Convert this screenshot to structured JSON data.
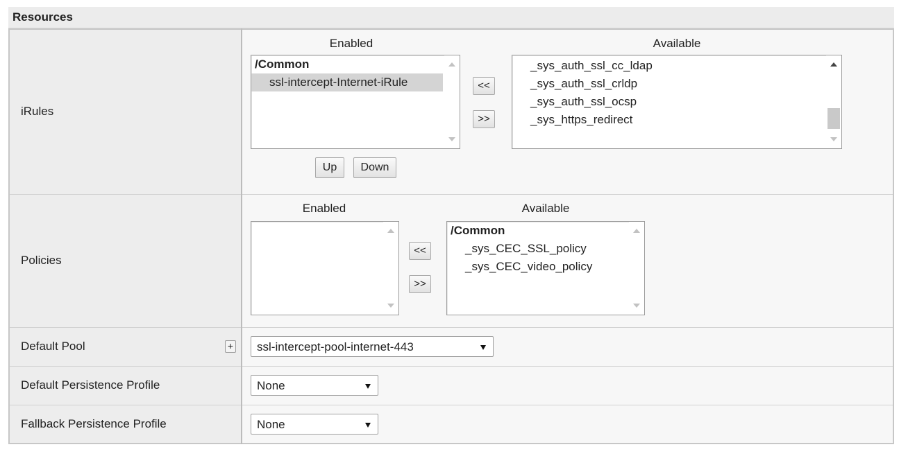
{
  "section": {
    "title": "Resources"
  },
  "irules": {
    "label": "iRules",
    "enabled_header": "Enabled",
    "available_header": "Available",
    "enabled_list": [
      {
        "text": "/Common",
        "type": "group"
      },
      {
        "text": "ssl-intercept-Internet-iRule",
        "type": "option",
        "selected": true
      }
    ],
    "available_list": [
      "_sys_auth_ssl_cc_ldap",
      "_sys_auth_ssl_crldp",
      "_sys_auth_ssl_ocsp",
      "_sys_https_redirect"
    ],
    "move_left": "<<",
    "move_right": ">>",
    "up": "Up",
    "down": "Down"
  },
  "policies": {
    "label": "Policies",
    "enabled_header": "Enabled",
    "available_header": "Available",
    "available_group": "/Common",
    "available_list": [
      "_sys_CEC_SSL_policy",
      "_sys_CEC_video_policy"
    ],
    "move_left": "<<",
    "move_right": ">>"
  },
  "default_pool": {
    "label": "Default Pool",
    "plus": "+",
    "value": "ssl-intercept-pool-internet-443"
  },
  "default_persistence": {
    "label": "Default Persistence Profile",
    "value": "None"
  },
  "fallback_persistence": {
    "label": "Fallback Persistence Profile",
    "value": "None"
  }
}
